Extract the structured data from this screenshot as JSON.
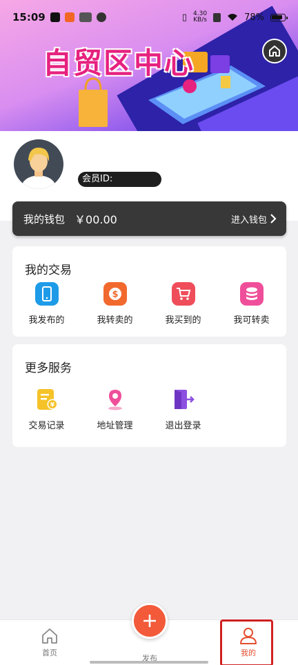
{
  "status_bar": {
    "time": "15:09",
    "net_speed_top": "4.30",
    "net_speed_bottom": "KB/s",
    "battery": "78%"
  },
  "banner": {
    "title": "自贸区中心"
  },
  "profile": {
    "member_id_label": "会员ID:"
  },
  "wallet": {
    "label": "我的钱包",
    "amount": "￥00.00",
    "enter_label": "进入钱包"
  },
  "trade_section": {
    "title": "我的交易",
    "items": [
      {
        "label": "我发布的",
        "icon": "phone-icon",
        "color": "#1e9be8"
      },
      {
        "label": "我转卖的",
        "icon": "dollar-icon",
        "color": "#f2692e"
      },
      {
        "label": "我买到的",
        "icon": "cart-icon",
        "color": "#ef4d5a"
      },
      {
        "label": "我可转卖",
        "icon": "database-icon",
        "color": "#ef4f9a"
      }
    ]
  },
  "services_section": {
    "title": "更多服务",
    "items": [
      {
        "label": "交易记录",
        "icon": "record-icon",
        "color": "#f5c228"
      },
      {
        "label": "地址管理",
        "icon": "location-pin-icon",
        "color": "#ef4f9a"
      },
      {
        "label": "退出登录",
        "icon": "logout-icon",
        "color": "#8c50e0"
      }
    ]
  },
  "tabbar": {
    "home_label": "首页",
    "publish_label": "发布",
    "mine_label": "我的",
    "active_color": "#e44d2e"
  }
}
